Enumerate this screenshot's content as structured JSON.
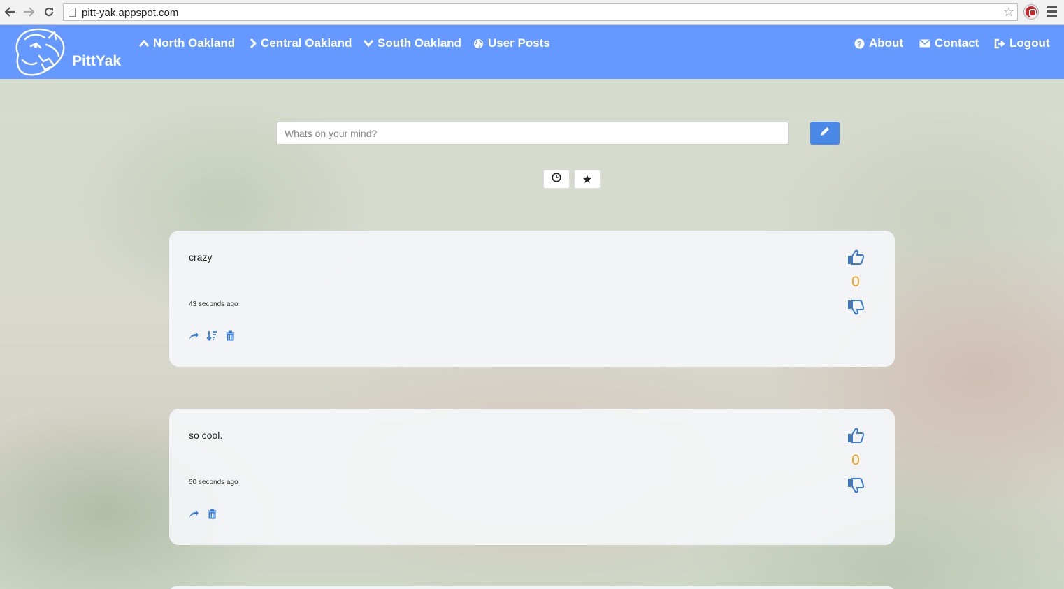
{
  "browser": {
    "url": "pitt-yak.appspot.com"
  },
  "brand": {
    "name": "PittYak"
  },
  "nav": {
    "left": [
      {
        "label": "North Oakland",
        "icon": "chevron-up-icon"
      },
      {
        "label": "Central Oakland",
        "icon": "chevron-right-icon"
      },
      {
        "label": "South Oakland",
        "icon": "chevron-down-icon"
      },
      {
        "label": "User Posts",
        "icon": "globe-icon"
      }
    ],
    "right": [
      {
        "label": "About",
        "icon": "question-circle-icon"
      },
      {
        "label": "Contact",
        "icon": "envelope-icon"
      },
      {
        "label": "Logout",
        "icon": "logout-icon"
      }
    ]
  },
  "composer": {
    "placeholder": "Whats on your mind?",
    "submit_icon": "pencil-icon"
  },
  "sort": {
    "recent_icon": "clock-icon",
    "top_icon": "star-icon",
    "top_glyph": "★"
  },
  "posts": [
    {
      "text": "crazy",
      "time": "43 seconds ago",
      "score": "0",
      "actions": [
        "share",
        "sort",
        "delete"
      ]
    },
    {
      "text": "so cool.",
      "time": "50 seconds ago",
      "score": "0",
      "actions": [
        "share",
        "delete"
      ]
    }
  ],
  "colors": {
    "navbar": "#6699ff",
    "accent_button": "#4a88e8",
    "icon_blue": "#3a7bd5",
    "score": "#f0a020"
  }
}
